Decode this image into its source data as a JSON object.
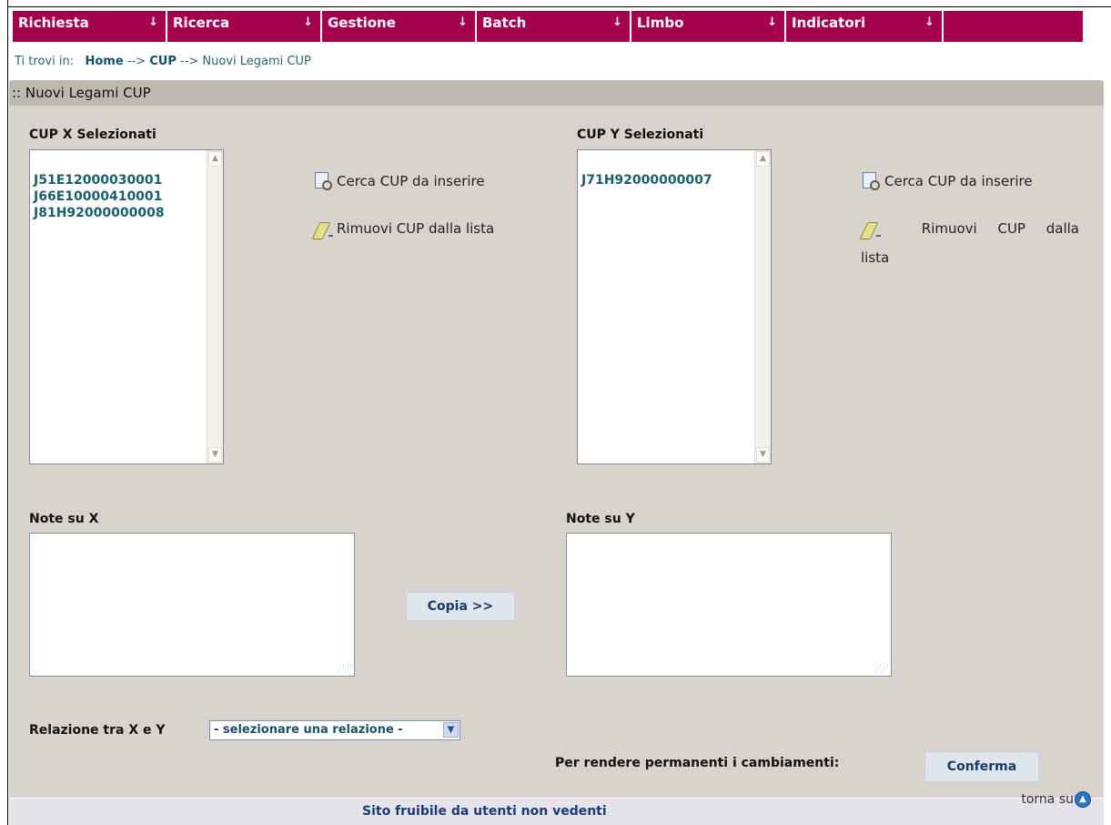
{
  "nav": [
    {
      "label": "Richiesta"
    },
    {
      "label": "Ricerca"
    },
    {
      "label": "Gestione"
    },
    {
      "label": "Batch"
    },
    {
      "label": "Limbo"
    },
    {
      "label": "Indicatori"
    }
  ],
  "breadcrumb": {
    "prefix": "Ti trovi in:",
    "home": "Home",
    "sep1": "-->",
    "cup": "CUP",
    "sep2": "-->",
    "current": "Nuovi Legami CUP"
  },
  "panel": {
    "title": ":: Nuovi Legami CUP",
    "x": {
      "label": "CUP X Selezionati",
      "items": [
        "J51E12000030001",
        "J66E10000410001",
        "J81H92000000008"
      ],
      "search_link": "Cerca CUP da inserire",
      "remove_link": "Rimuovi CUP dalla lista",
      "notes_label": "Note su X"
    },
    "y": {
      "label": "CUP Y Selezionati",
      "items": [
        "J71H92000000007"
      ],
      "search_link": "Cerca CUP da inserire",
      "remove_link_1": "Rimuovi CUP dalla",
      "remove_link_2": "lista",
      "notes_label": "Note su Y"
    },
    "copy_button": "Copia >>",
    "relation_label": "Relazione tra X e Y",
    "relation_select": "- selezionare una relazione -",
    "confirm_prompt": "Per rendere permanenti i cambiamenti:",
    "confirm_button": "Conferma"
  },
  "footer": {
    "accessibility": "Sito fruibile da utenti non vedenti",
    "back_to_top": "torna su"
  }
}
